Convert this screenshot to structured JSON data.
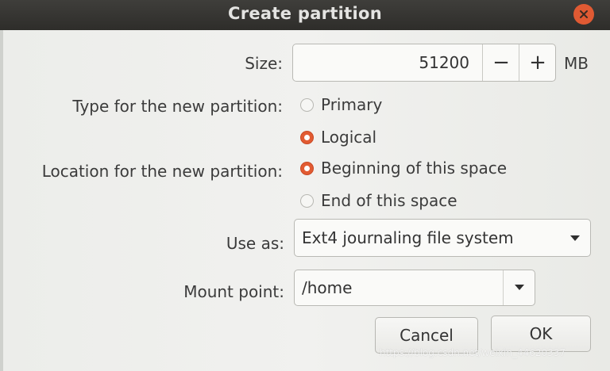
{
  "window": {
    "title": "Create partition",
    "close_icon": "close-icon"
  },
  "size": {
    "label": "Size:",
    "value": "51200",
    "decrement_label": "−",
    "increment_label": "+",
    "unit": "MB"
  },
  "partition_type": {
    "label": "Type for the new partition:",
    "options": [
      {
        "label": "Primary",
        "selected": false
      },
      {
        "label": "Logical",
        "selected": true
      }
    ]
  },
  "location": {
    "label": "Location for the new partition:",
    "options": [
      {
        "label": "Beginning of this space",
        "selected": true
      },
      {
        "label": "End of this space",
        "selected": false
      }
    ]
  },
  "use_as": {
    "label": "Use as:",
    "value": "Ext4 journaling file system"
  },
  "mount_point": {
    "label": "Mount point:",
    "value": "/home"
  },
  "actions": {
    "cancel_label": "Cancel",
    "ok_label": "OK"
  },
  "watermark": "https://blog.csdn.net/weixin_44620337",
  "colors": {
    "accent": "#e25b32",
    "titlebar": "#2e2d2a",
    "dialog_background": "#f1f1ef"
  }
}
